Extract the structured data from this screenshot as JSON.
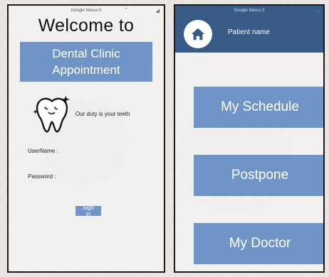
{
  "left_screen": {
    "status_title": "Google Nexus 5",
    "title": "Welcome to",
    "banner_line1": "Dental Clinic",
    "banner_line2": "Appointment",
    "slogan": "Our duty is your teeth",
    "username_label": "UserName :",
    "password_label": "Password :",
    "signin_label": "Sign in",
    "icons": [
      "tooth-icon"
    ]
  },
  "right_screen": {
    "status_title": "Google Nexus 5",
    "patient_name": "Patient name",
    "menu": [
      "My Schedule",
      "Postpone",
      "My Doctor"
    ],
    "icons": [
      "home-icon"
    ]
  },
  "colors": {
    "accent": "#6f95c8",
    "header": "#375a86"
  }
}
